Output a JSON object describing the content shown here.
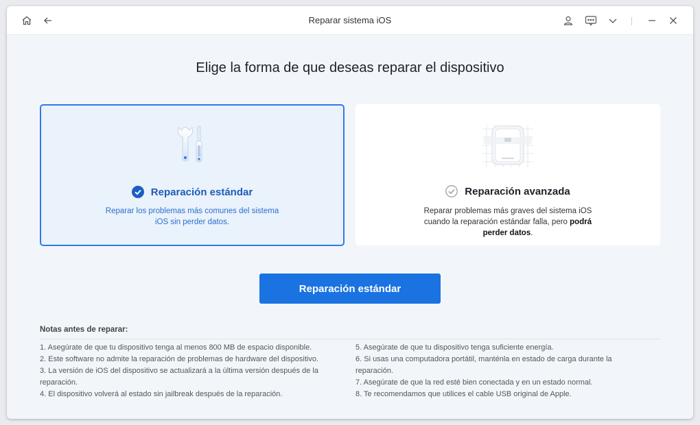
{
  "window": {
    "title": "Reparar sistema iOS"
  },
  "heading": "Elige la forma de que deseas reparar el dispositivo",
  "options": {
    "standard": {
      "title": "Reparación estándar",
      "description_line1": "Reparar los problemas más comunes del sistema",
      "description_line2": "iOS sin perder datos.",
      "selected": true
    },
    "advanced": {
      "title": "Reparación avanzada",
      "description_line1": "Reparar problemas más graves del sistema iOS",
      "description_line2": "cuando la reparación estándar falla, pero",
      "description_bold1": "podrá",
      "description_bold2": "perder datos",
      "description_end": ".",
      "selected": false
    }
  },
  "primary_button": "Reparación estándar",
  "notes": {
    "title": "Notas antes de reparar:",
    "left": [
      "1.  Asegúrate de que tu dispositivo tenga al menos 800 MB de espacio disponible.",
      "2.  Este software no admite la reparación de problemas de hardware del dispositivo.",
      "3.  La versión de iOS del dispositivo se actualizará a la última versión después de la",
      "reparación.",
      "4.  El dispositivo volverá al estado sin jailbreak después de la reparación."
    ],
    "right": [
      "5.  Asegúrate de que tu dispositivo tenga suficiente energía.",
      "6.  Si usas una computadora portátil, manténla en estado de carga durante la",
      "reparación.",
      "7.  Asegúrate de que la red esté bien conectada y en un estado normal.",
      "8.  Te recomendamos que utilices el cable USB original de Apple."
    ]
  },
  "icons": {
    "home": "home-icon",
    "back": "back-arrow-icon",
    "user": "user-icon",
    "feedback": "chat-icon",
    "menu": "chevron-down-icon",
    "minimize": "minimize-icon",
    "close": "close-icon"
  },
  "colors": {
    "accent": "#1a73e0",
    "selected_border": "#2d7be5",
    "selected_bg": "#eaf2fc"
  }
}
